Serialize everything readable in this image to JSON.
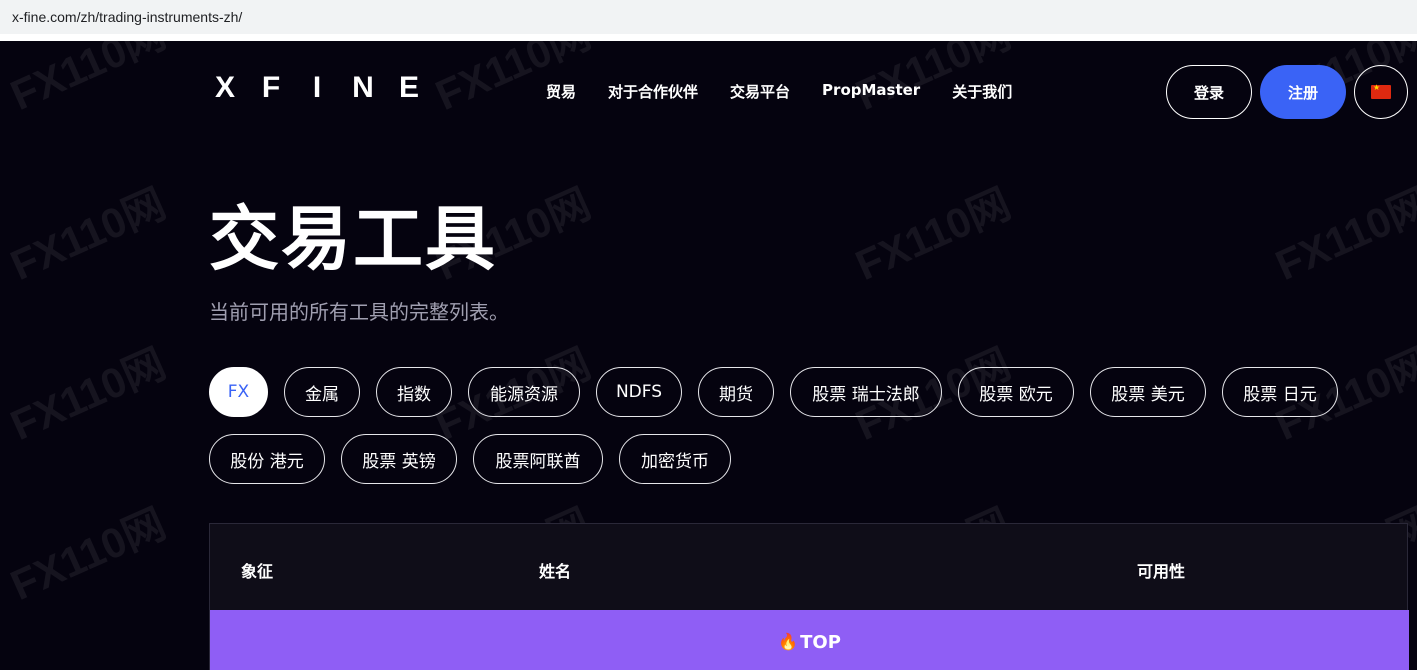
{
  "browser": {
    "url": "x-fine.com/zh/trading-instruments-zh/"
  },
  "header": {
    "logo_letters": [
      "X",
      "F",
      "I",
      "N",
      "E"
    ],
    "nav": [
      "贸易",
      "对于合作伙伴",
      "交易平台",
      "PropMaster",
      "关于我们"
    ],
    "login_label": "登录",
    "register_label": "注册",
    "language_icon": "china-flag-icon"
  },
  "hero": {
    "title": "交易工具",
    "subtitle": "当前可用的所有工具的完整列表。"
  },
  "filters": {
    "active": "FX",
    "items": [
      "FX",
      "金属",
      "指数",
      "能源资源",
      "NDFS",
      "期货",
      "股票 瑞士法郎",
      "股票 欧元",
      "股票 美元",
      "股票 日元",
      "股份 港元",
      "股票 英镑",
      "股票阿联酋",
      "加密货币"
    ]
  },
  "table": {
    "headers": [
      "象征",
      "姓名",
      "可用性"
    ],
    "top_row_label": "TOP",
    "top_row_icon": "fire-icon"
  },
  "watermark": "FX110网",
  "colors": {
    "accent": "#3a63f6",
    "top_row": "#8f5ef5",
    "background": "#05030f"
  }
}
